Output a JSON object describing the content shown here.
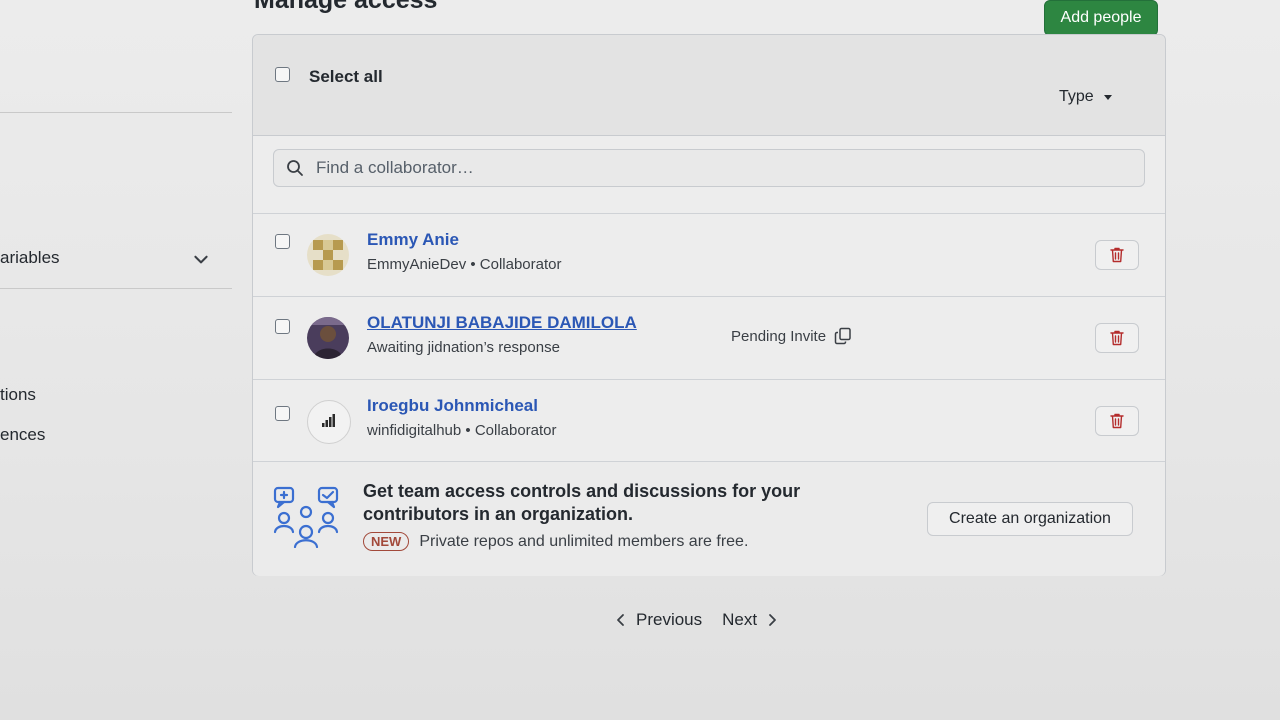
{
  "header": {
    "title": "Manage access",
    "add_people_label": "Add people"
  },
  "sidebar": {
    "items": [
      {
        "label": "ariables"
      },
      {
        "label": "tions"
      },
      {
        "label": "ences"
      }
    ]
  },
  "toolbar": {
    "select_all_label": "Select all",
    "type_filter_label": "Type"
  },
  "search": {
    "placeholder": "Find a collaborator…"
  },
  "collaborators": [
    {
      "name": "Emmy Anie",
      "meta": "EmmyAnieDev • Collaborator"
    },
    {
      "name": "OLATUNJI BABAJIDE DAMILOLA",
      "meta": "Awaiting jidnation’s response",
      "status": "Pending Invite"
    },
    {
      "name": "Iroegbu Johnmicheal",
      "meta": "winfidigitalhub • Collaborator"
    }
  ],
  "promo": {
    "title": "Get team access controls and discussions for your contributors in an organization.",
    "badge": "NEW",
    "subtitle": "Private repos and unlimited members are free.",
    "cta_label": "Create an organization"
  },
  "pagination": {
    "previous_label": "Previous",
    "next_label": "Next"
  },
  "colors": {
    "primary_button": "#2d8641",
    "link": "#2b57b5",
    "danger": "#b42c2c",
    "badge": "#a2493a"
  }
}
